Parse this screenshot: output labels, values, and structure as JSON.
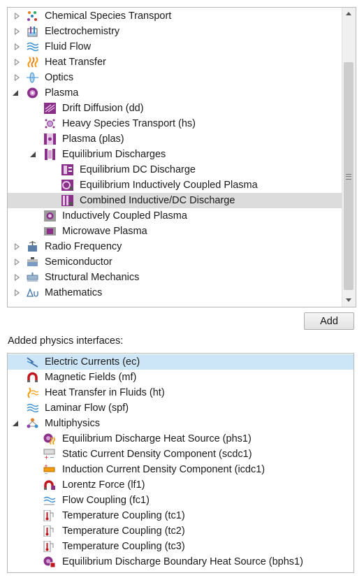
{
  "tree": {
    "items": [
      {
        "label": "Chemical Species Transport",
        "icon": "chemical-species-icon"
      },
      {
        "label": "Electrochemistry",
        "icon": "electrochemistry-icon"
      },
      {
        "label": "Fluid Flow",
        "icon": "fluid-flow-icon"
      },
      {
        "label": "Heat Transfer",
        "icon": "heat-transfer-icon"
      },
      {
        "label": "Optics",
        "icon": "optics-icon"
      },
      {
        "label": "Plasma",
        "icon": "plasma-icon"
      },
      {
        "label": "Drift Diffusion (dd)",
        "icon": "drift-diffusion-icon"
      },
      {
        "label": "Heavy Species Transport (hs)",
        "icon": "heavy-species-icon"
      },
      {
        "label": "Plasma (plas)",
        "icon": "plasma-plas-icon"
      },
      {
        "label": "Equilibrium Discharges",
        "icon": "equilibrium-discharges-icon"
      },
      {
        "label": "Equilibrium DC Discharge",
        "icon": "equilibrium-dc-icon"
      },
      {
        "label": "Equilibrium Inductively Coupled Plasma",
        "icon": "equilibrium-icp-icon"
      },
      {
        "label": "Combined Inductive/DC Discharge",
        "icon": "combined-discharge-icon"
      },
      {
        "label": "Inductively Coupled Plasma",
        "icon": "icp-icon"
      },
      {
        "label": "Microwave Plasma",
        "icon": "microwave-plasma-icon"
      },
      {
        "label": "Radio Frequency",
        "icon": "radio-frequency-icon"
      },
      {
        "label": "Semiconductor",
        "icon": "semiconductor-icon"
      },
      {
        "label": "Structural Mechanics",
        "icon": "structural-mechanics-icon"
      },
      {
        "label": "Mathematics",
        "icon": "mathematics-icon"
      }
    ]
  },
  "add_button": "Add",
  "added_label": "Added physics interfaces:",
  "added": {
    "items": [
      {
        "label": "Electric Currents (ec)",
        "icon": "electric-currents-icon"
      },
      {
        "label": "Magnetic Fields (mf)",
        "icon": "magnetic-fields-icon"
      },
      {
        "label": "Heat Transfer in Fluids (ht)",
        "icon": "heat-transfer-fluids-icon"
      },
      {
        "label": "Laminar Flow (spf)",
        "icon": "laminar-flow-icon"
      },
      {
        "label": "Multiphysics",
        "icon": "multiphysics-icon"
      },
      {
        "label": "Equilibrium Discharge Heat Source (phs1)",
        "icon": "heat-source-icon"
      },
      {
        "label": "Static Current Density Component (scdc1)",
        "icon": "static-current-icon"
      },
      {
        "label": "Induction Current Density Component (icdc1)",
        "icon": "induction-current-icon"
      },
      {
        "label": "Lorentz Force (lf1)",
        "icon": "lorentz-force-icon"
      },
      {
        "label": "Flow Coupling (fc1)",
        "icon": "flow-coupling-icon"
      },
      {
        "label": "Temperature Coupling (tc1)",
        "icon": "temperature-coupling-icon"
      },
      {
        "label": "Temperature Coupling (tc2)",
        "icon": "temperature-coupling-icon"
      },
      {
        "label": "Temperature Coupling (tc3)",
        "icon": "temperature-coupling-icon"
      },
      {
        "label": "Equilibrium Discharge Boundary Heat Source (bphs1)",
        "icon": "boundary-heat-source-icon"
      }
    ]
  },
  "colors": {
    "plasma_purple": "#8a2f8a",
    "selected_gray": "#dcdcdc",
    "selected_blue": "#cde6f7",
    "heat_orange": "#f39c12",
    "magnet_red": "#c0171f"
  }
}
